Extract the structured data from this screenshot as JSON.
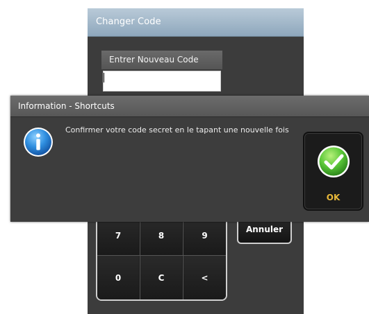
{
  "code_window": {
    "title": "Changer Code",
    "entry_label": "Entrer Nouveau Code",
    "entry_value": "",
    "keypad": [
      "7",
      "8",
      "9",
      "0",
      "C",
      "<"
    ],
    "cancel_label": "Annuler"
  },
  "info_dialog": {
    "title": "Information - Shortcuts",
    "message": "Confirmer votre code secret en le tapant une nouvelle fois",
    "icon": "info-icon",
    "ok_label": "OK",
    "ok_icon": "check-icon"
  },
  "colors": {
    "title_bar_blue": "#8ea7bc",
    "dialog_bg": "#3d3d3d",
    "ok_text": "#e9b93a",
    "check_green": "#5cc83a"
  }
}
